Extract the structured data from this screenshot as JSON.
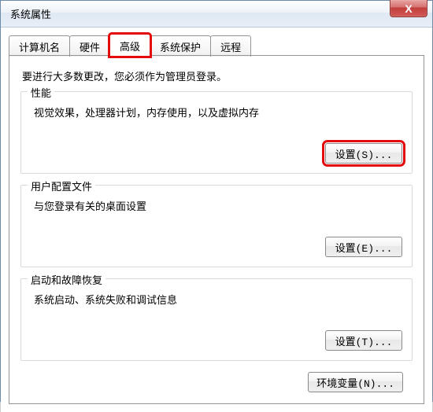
{
  "window": {
    "title": "系统属性",
    "close_label": "X"
  },
  "tabs": {
    "computer_name": "计算机名",
    "hardware": "硬件",
    "advanced": "高级",
    "system_protection": "系统保护",
    "remote": "远程"
  },
  "intro": "要进行大多数更改，您必须作为管理员登录。",
  "groups": {
    "performance": {
      "title": "性能",
      "desc": "视觉效果，处理器计划，内存使用，以及虚拟内存",
      "btn": "设置(S)..."
    },
    "user_profiles": {
      "title": "用户配置文件",
      "desc": "与您登录有关的桌面设置",
      "btn": "设置(E)..."
    },
    "startup_recovery": {
      "title": "启动和故障恢复",
      "desc": "系统启动、系统失败和调试信息",
      "btn": "设置(T)..."
    }
  },
  "env_btn": "环境变量(N)..."
}
